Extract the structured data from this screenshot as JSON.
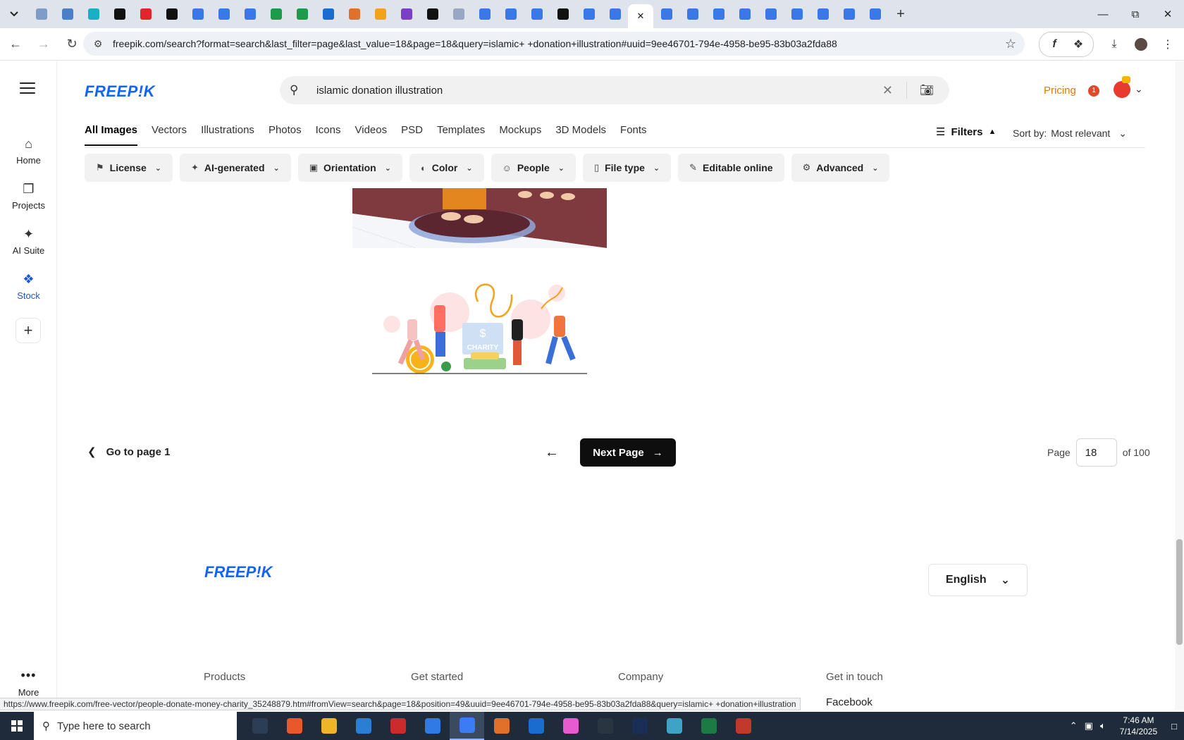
{
  "browser": {
    "url": "freepik.com/search?format=search&last_filter=page&last_value=18&page=18&query=islamic+ +donation+illustration#uuid=9ee46701-794e-4958-be95-83b03a2fda88",
    "tab_favicon_colors": [
      "#7f9cc9",
      "#4a7ec8",
      "#1ab0c4",
      "#111111",
      "#e0262a",
      "#111111",
      "#3b78e7",
      "#3b78e7",
      "#3b78e7",
      "#1e9b4a",
      "#1e9b4a",
      "#1a6ccf",
      "#e0702a",
      "#f2a31b",
      "#7b3fc4",
      "#111111",
      "#9aa7c2",
      "#3b78e7",
      "#3b78e7",
      "#3b78e7",
      "#111111",
      "#3b78e7",
      "#3b78e7"
    ],
    "active_tab_close": "✕",
    "tab_favicon_colors_after": [
      "#3b78e7",
      "#3b78e7",
      "#3b78e7",
      "#3b78e7",
      "#3b78e7",
      "#3b78e7",
      "#3b78e7",
      "#3b78e7",
      "#3b78e7"
    ],
    "new_tab": "+",
    "status_link": "https://www.freepik.com/free-vector/people-donate-money-charity_35248879.htm#fromView=search&page=18&position=49&uuid=9ee46701-794e-4958-be95-83b03a2fda88&query=islamic+ +donation+illustration"
  },
  "app": {
    "logo": "FREEP!K",
    "search": {
      "query": "islamic  donation illustration"
    },
    "pricing": "Pricing",
    "notification_count": "1"
  },
  "rail": {
    "items": [
      {
        "label": "Home",
        "icon": "home-icon"
      },
      {
        "label": "Projects",
        "icon": "projects-icon"
      },
      {
        "label": "AI Suite",
        "icon": "ai-suite-icon"
      },
      {
        "label": "Stock",
        "icon": "stock-icon"
      }
    ],
    "more": "More"
  },
  "categories": [
    "All Images",
    "Vectors",
    "Illustrations",
    "Photos",
    "Icons",
    "Videos",
    "PSD",
    "Templates",
    "Mockups",
    "3D Models",
    "Fonts"
  ],
  "filters_label": "Filters",
  "sort": {
    "label": "Sort by:",
    "value": "Most relevant"
  },
  "chips": [
    {
      "label": "License",
      "icon": "license-icon"
    },
    {
      "label": "AI-generated",
      "icon": "ai-icon"
    },
    {
      "label": "Orientation",
      "icon": "orientation-icon"
    },
    {
      "label": "Color",
      "icon": "palette-icon"
    },
    {
      "label": "People",
      "icon": "people-icon"
    },
    {
      "label": "File type",
      "icon": "file-icon"
    },
    {
      "label": "Editable online",
      "icon": "pencil-icon"
    },
    {
      "label": "Advanced",
      "icon": "settings-icon"
    }
  ],
  "results": {
    "image2_text": "CHARITY",
    "image2_currency": "$"
  },
  "pagination": {
    "goto": "Go to page 1",
    "next": "Next Page",
    "page_label": "Page",
    "current_page": "18",
    "of_total": "of 100"
  },
  "footer": {
    "logo": "FREEP!K",
    "language": "English",
    "columns": [
      "Products",
      "Get started",
      "Company",
      "Get in touch"
    ],
    "contact_first": "Facebook"
  },
  "taskbar": {
    "search_placeholder": "Type here to search",
    "time": "7:46 AM",
    "date": "7/14/2025",
    "app_colors": [
      "#2c3e55",
      "#e8582a",
      "#f0b429",
      "#2a7fd4",
      "#cc2b2b",
      "#2f7ae5",
      "#3b7cf4",
      "#e0702a",
      "#1a6ccf",
      "#e85ad0",
      "#2a3542",
      "#1b2f56",
      "#3fa3c7",
      "#1d7a45",
      "#c0392b"
    ]
  }
}
